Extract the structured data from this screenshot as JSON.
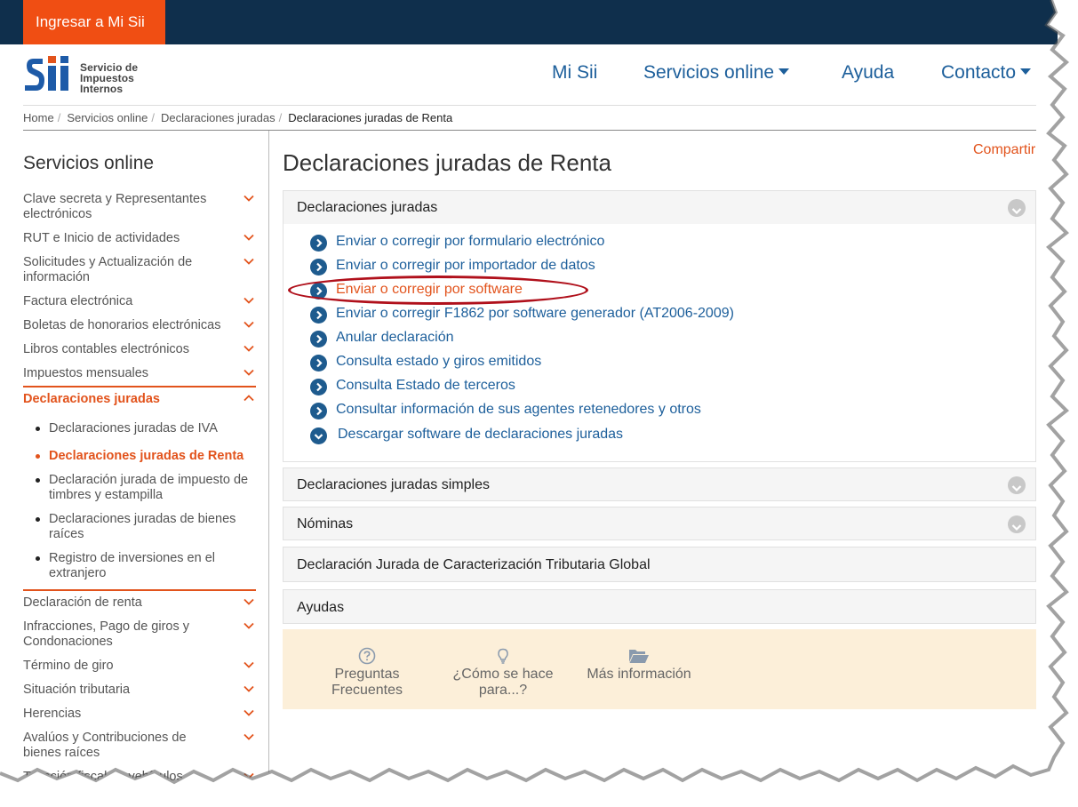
{
  "topbar": {
    "login_label": "Ingresar a Mi Sii"
  },
  "logo": {
    "mark_text": "Sii",
    "lines": [
      "Servicio de",
      "Impuestos",
      "Internos"
    ]
  },
  "nav": {
    "items": [
      {
        "label": "Mi Sii"
      },
      {
        "label": "Servicios online"
      },
      {
        "label": "Ayuda"
      },
      {
        "label": "Contacto"
      }
    ]
  },
  "breadcrumb": {
    "items": [
      "Home",
      "Servicios online",
      "Declaraciones juradas"
    ],
    "current": "Declaraciones juradas de Renta",
    "separator": "/"
  },
  "sidebar": {
    "title": "Servicios online",
    "items": [
      {
        "label": "Clave secreta y Representantes electrónicos"
      },
      {
        "label": "RUT e Inicio de actividades"
      },
      {
        "label": "Solicitudes y Actualización de información"
      },
      {
        "label": "Factura electrónica"
      },
      {
        "label": "Boletas de honorarios electrónicas"
      },
      {
        "label": "Libros contables electrónicos"
      },
      {
        "label": "Impuestos mensuales"
      },
      {
        "label": "Declaraciones juradas"
      },
      {
        "label": "Declaración de renta"
      },
      {
        "label": "Infracciones, Pago de giros y Condonaciones"
      },
      {
        "label": "Término de giro"
      },
      {
        "label": "Situación tributaria"
      },
      {
        "label": "Herencias"
      },
      {
        "label": "Avalúos y Contribuciones de bienes raíces"
      },
      {
        "label": "Tasación fiscal de vehículos"
      }
    ],
    "subitems": [
      {
        "label": "Declaraciones juradas de IVA"
      },
      {
        "label": "Declaraciones juradas de Renta"
      },
      {
        "label": "Declaración jurada de impuesto de timbres y estampilla"
      },
      {
        "label": "Declaraciones juradas de bienes raíces"
      },
      {
        "label": "Registro de inversiones en el extranjero"
      }
    ]
  },
  "main": {
    "title": "Declaraciones juradas de Renta",
    "share_label": "Compartir",
    "panels": [
      {
        "label": "Declaraciones juradas"
      },
      {
        "label": "Declaraciones juradas simples"
      },
      {
        "label": "Nóminas"
      },
      {
        "label": "Declaración Jurada de Caracterización Tributaria Global"
      },
      {
        "label": "Ayudas"
      }
    ],
    "links": [
      {
        "label": "Enviar o corregir por formulario electrónico"
      },
      {
        "label": "Enviar o corregir por importador de datos"
      },
      {
        "label": "Enviar o corregir por software"
      },
      {
        "label": "Enviar o corregir F1862 por software generador (AT2006-2009)"
      },
      {
        "label": "Anular declaración"
      },
      {
        "label": "Consulta estado y giros emitidos"
      },
      {
        "label": "Consulta Estado de terceros"
      },
      {
        "label": "Consultar información de sus agentes retenedores y otros"
      },
      {
        "label": "Descargar software de declaraciones juradas"
      }
    ],
    "help": [
      {
        "line1": "Preguntas",
        "line2": "Frecuentes",
        "icon": "question-circle-icon"
      },
      {
        "line1": "¿Cómo se hace",
        "line2": "para...?",
        "icon": "lightbulb-icon"
      },
      {
        "line1": "Más información",
        "line2": "",
        "icon": "folder-open-icon"
      }
    ]
  },
  "colors": {
    "topbar": "#0f2f4c",
    "brand_orange": "#f04e13",
    "link_blue": "#1d5f9b",
    "highlight_oval": "#b0101b"
  }
}
